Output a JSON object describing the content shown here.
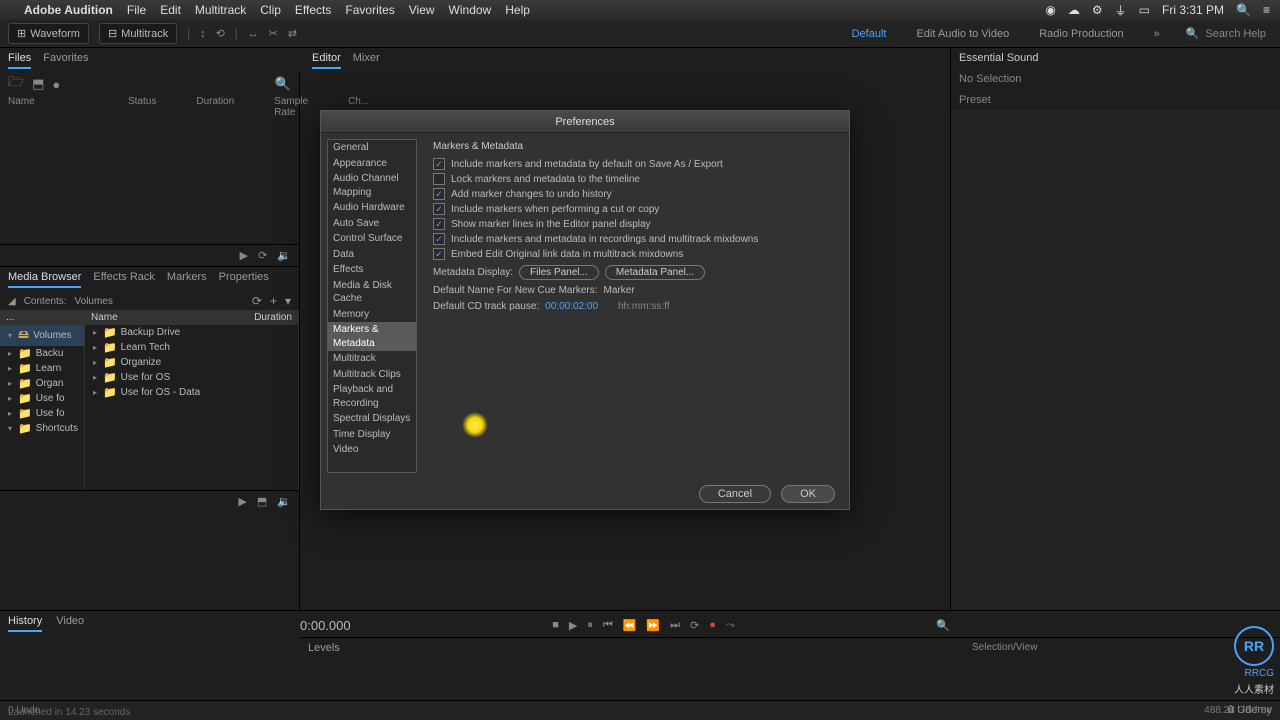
{
  "mac": {
    "app_name": "Adobe Audition",
    "menus": [
      "File",
      "Edit",
      "Multitrack",
      "Clip",
      "Effects",
      "Favorites",
      "View",
      "Window",
      "Help"
    ],
    "clock": "Fri 3:31 PM"
  },
  "topbar": {
    "waveform": "Waveform",
    "multitrack": "Multitrack",
    "workspaces": [
      "Default",
      "Edit Audio to Video",
      "Radio Production"
    ],
    "active_workspace": "Default",
    "search_placeholder": "Search Help"
  },
  "subheader": {
    "left": [
      "Files",
      "Favorites"
    ],
    "left_active": "Files",
    "right": [
      "Editor",
      "Mixer"
    ],
    "right_active": "Editor"
  },
  "files_panel": {
    "headers": [
      "Name",
      "Status",
      "Duration",
      "Sample Rate",
      "Ch..."
    ]
  },
  "media_browser": {
    "tabs": [
      "Media Browser",
      "Effects Rack",
      "Markers",
      "Properties"
    ],
    "active_tab": "Media Browser",
    "contents_label": "Contents:",
    "contents_value": "Volumes",
    "left_header": "Volumes",
    "right_header": "Name",
    "right_header2": "Duration",
    "left_items": [
      "Backu",
      "Learn",
      "Organ",
      "Use fo",
      "Use fo"
    ],
    "right_items": [
      "Backup Drive",
      "Learn Tech",
      "Organize",
      "Use for OS",
      "Use for OS - Data"
    ],
    "shortcuts": "Shortcuts"
  },
  "essential_sound": {
    "title": "Essential Sound",
    "no_selection": "No Selection",
    "preset": "Preset"
  },
  "transport": {
    "time": "0:00.000"
  },
  "levels_label": "Levels",
  "history": {
    "tabs": [
      "History",
      "Video"
    ],
    "active": "History"
  },
  "status": {
    "undo": "0 Undo",
    "launched": "Launched in 14.23 seconds",
    "storage": "488.28 GB free"
  },
  "dialog": {
    "title": "Preferences",
    "categories": [
      "General",
      "Appearance",
      "Audio Channel Mapping",
      "Audio Hardware",
      "Auto Save",
      "Control Surface",
      "Data",
      "Effects",
      "Media & Disk Cache",
      "Memory",
      "Markers & Metadata",
      "Multitrack",
      "Multitrack Clips",
      "Playback and Recording",
      "Spectral Displays",
      "Time Display",
      "Video"
    ],
    "active_category": "Markers & Metadata",
    "section_title": "Markers & Metadata",
    "checkboxes": [
      {
        "label": "Include markers and metadata by default on Save As / Export",
        "checked": true
      },
      {
        "label": "Lock markers and metadata to the timeline",
        "checked": false
      },
      {
        "label": "Add marker changes to undo history",
        "checked": true
      },
      {
        "label": "Include markers when performing a cut or copy",
        "checked": true
      },
      {
        "label": "Show marker lines in the Editor panel display",
        "checked": true
      },
      {
        "label": "Include markers and metadata in recordings and multitrack mixdowns",
        "checked": true
      },
      {
        "label": "Embed Edit Original link data in multitrack mixdowns",
        "checked": true
      }
    ],
    "metadata_display_label": "Metadata Display:",
    "metadata_btn1": "Files Panel...",
    "metadata_btn2": "Metadata Panel...",
    "default_name_label": "Default Name For New Cue Markers:",
    "default_name_value": "Marker",
    "cd_pause_label": "Default CD track pause:",
    "cd_pause_value": "00:00:02:00",
    "cd_pause_hint": "hh:mm:ss:ff",
    "cancel": "Cancel",
    "ok": "OK"
  },
  "selection_view": "Selection/View",
  "udemy": "Udemy"
}
